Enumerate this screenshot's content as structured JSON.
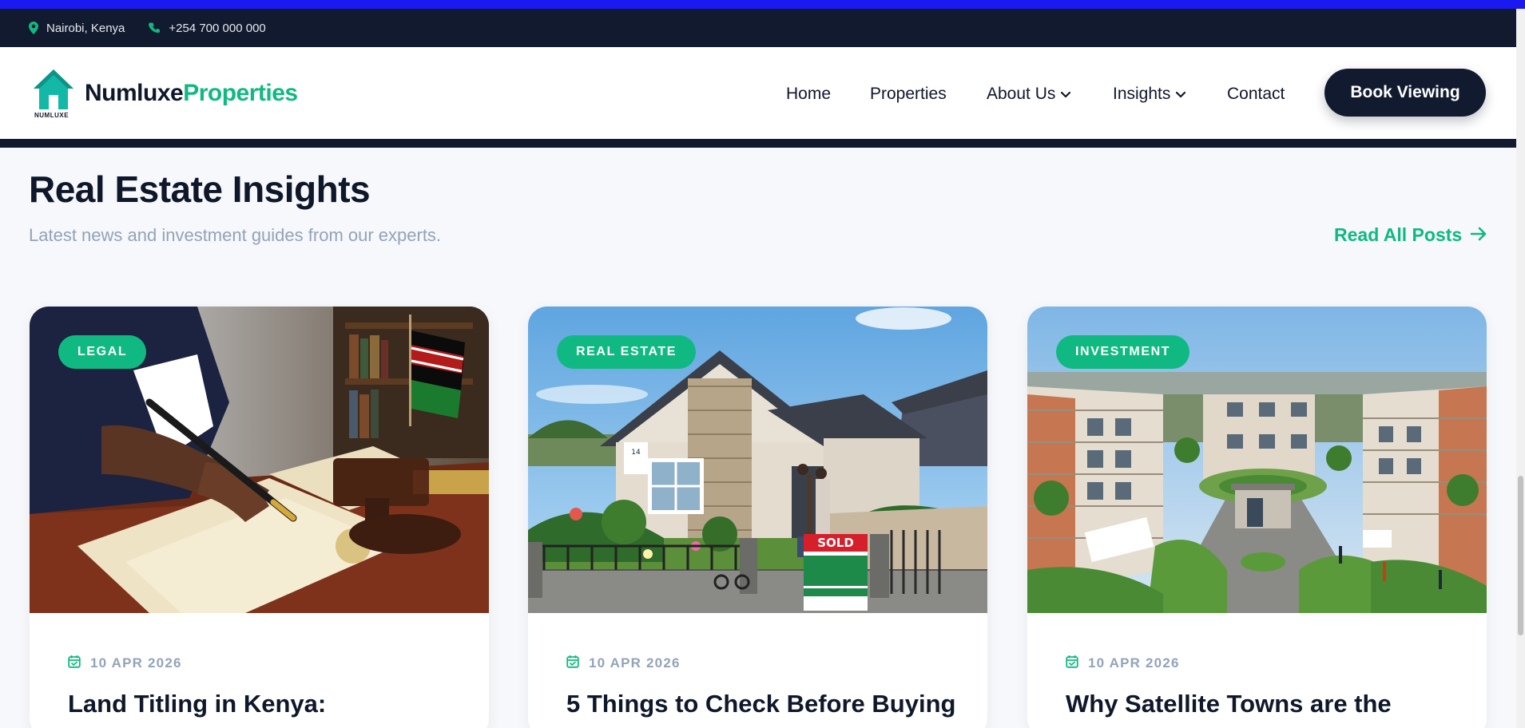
{
  "topbar": {
    "location": "Nairobi, Kenya",
    "phone": "+254 700 000 000"
  },
  "brand": {
    "name_part1": "Numluxe",
    "name_part2": "Properties",
    "logo_tag": "NUMLUXE"
  },
  "nav": {
    "items": [
      {
        "label": "Home",
        "dropdown": false
      },
      {
        "label": "Properties",
        "dropdown": false
      },
      {
        "label": "About Us",
        "dropdown": true
      },
      {
        "label": "Insights",
        "dropdown": true
      },
      {
        "label": "Contact",
        "dropdown": false
      }
    ],
    "cta_label": "Book Viewing"
  },
  "insights": {
    "title": "Real Estate Insights",
    "subtitle": "Latest news and investment guides from our experts.",
    "read_all_label": "Read All Posts"
  },
  "cards": [
    {
      "category": "LEGAL",
      "date": "10 APR 2026",
      "title": "Land Titling in Kenya:"
    },
    {
      "category": "REAL ESTATE",
      "date": "10 APR 2026",
      "title": "5 Things to Check Before Buying"
    },
    {
      "category": "INVESTMENT",
      "date": "10 APR 2026",
      "title": "Why Satellite Towns are the"
    }
  ],
  "colors": {
    "accent": "#10b981",
    "navy": "#111a2e",
    "muted": "#94a3b8"
  },
  "icons": {
    "location": "map-pin-icon",
    "phone": "phone-icon",
    "chevron": "chevron-down-icon",
    "arrow": "arrow-right-icon",
    "date": "calendar-check-icon"
  }
}
